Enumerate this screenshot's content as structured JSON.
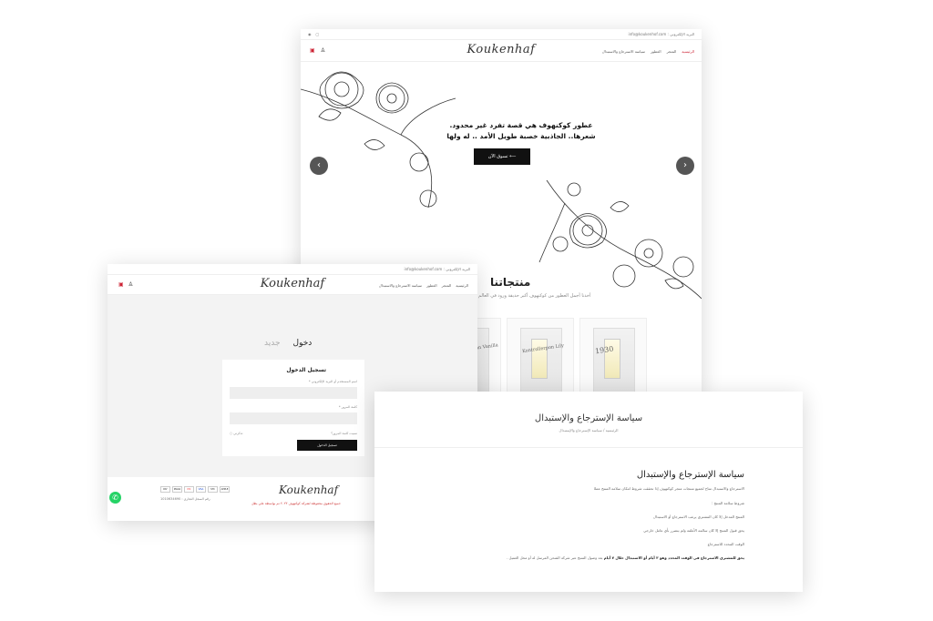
{
  "brand": {
    "logo": "Koukenhaf"
  },
  "home": {
    "contact": "البريد الإلكتروني : info@koukenhof.com",
    "menu": [
      "الرئيسية",
      "المتجر",
      "العطور",
      "سياسة الاسترجاع والاستبدال"
    ],
    "hero_text": "عطور كوكنهوف هي قصة تفرد غير محدود. شعرها.. الجاذبية خصبة طويل الأمد .. له ولها",
    "hero_button": "تسوق الآن ⟵",
    "products_title": "منتجاتنا",
    "products_subtitle": "أخذنا أجمل العطور من كوكنهوف أكبر حديقة ورود في العالم",
    "products": [
      {
        "label": "1930"
      },
      {
        "label": "Kontrollerpon Lily"
      },
      {
        "label": "Kontrollerpon Vanilla"
      }
    ]
  },
  "login": {
    "contact": "البريد الإلكتروني : info@koukenhof.com",
    "menu": [
      "الرئيسية",
      "المتجر",
      "العطور",
      "سياسة الاسترجاع والاستبدال"
    ],
    "tab_login": "دخول",
    "tab_new": "جديد",
    "card_title": "تسجيل الدخول",
    "username_label": "اسم المستخدم أو البريد الإلكتروني *",
    "password_label": "كلمة المرور *",
    "remember": "تذكرني",
    "lost_password": "نسيت كلمة المرور؟",
    "submit": "تسجيل الدخول",
    "copyright": "جميع الحقوق محفوظة لشركة كوكنهوف ٢٠٢٣ تم بواسطة علي بطل",
    "tax_number": "رقم السجل التجاري : 1010634690",
    "payments": [
      "PAY",
      "MADA",
      "MC",
      "VISA",
      "STC",
      "APPLE"
    ]
  },
  "policy": {
    "title": "سياسة الإسترجاع والإستبدال",
    "breadcrumb": "الرئيسية / سياسة الإسترجاع والإستبدال",
    "heading": "سياسة الإسترجاع والإستبدال",
    "para1": "الاسترجاع والاستبدال متاح لجميع منتجات متجر كوكنهوف إذا تحققت شروط امكان سلامة المنتج عملا",
    "para2": "شروط سلامة المنتج :",
    "para3": "المنتج المدخل إلا كان المشتري يرغب الاسترجاع أو الاستبدال",
    "para4": "يحق قبول المنتج إلا كان سالمه الأغلفة ولم يتضرر بأي عامل خارجي",
    "para5": "الوقت المحدد للاسترجاع",
    "para6_bold": "يحق للمشتري الاسترجاع في الوقت المحدد وهو ٣ أيام أو الاستبدال خلال ٧ أيام",
    "para6_rest": " بعد وصول المنتج عبر شركة الشحن المرسل له أو محل العميل ."
  }
}
